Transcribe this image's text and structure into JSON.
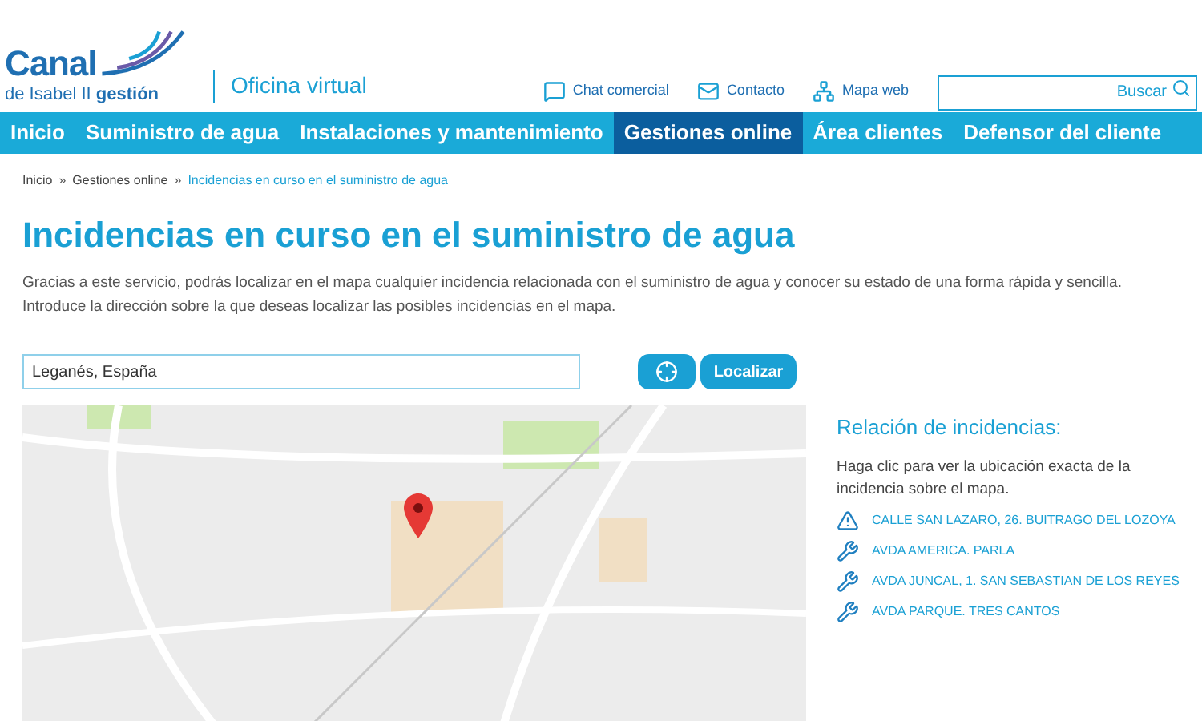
{
  "logo": {
    "name": "Canal",
    "subtitle_regular": "de Isabel II",
    "subtitle_bold": "gestión",
    "section": "Oficina virtual"
  },
  "header_links": [
    {
      "label": "Chat comercial",
      "kind": "chat"
    },
    {
      "label": "Contacto",
      "kind": "mail"
    },
    {
      "label": "Mapa web",
      "kind": "sitemap"
    }
  ],
  "search": {
    "placeholder": "Buscar"
  },
  "nav": [
    {
      "label": "Inicio",
      "selected": false
    },
    {
      "label": "Suministro de agua",
      "selected": false
    },
    {
      "label": "Instalaciones y mantenimiento",
      "selected": false
    },
    {
      "label": "Gestiones online",
      "selected": true
    },
    {
      "label": "Área clientes",
      "selected": false
    },
    {
      "label": "Defensor del cliente",
      "selected": false
    }
  ],
  "breadcrumb": {
    "separator": "»",
    "items": [
      "Inicio",
      "Gestiones online",
      "Incidencias en curso en el suministro de agua"
    ]
  },
  "title": "Incidencias en curso en el suministro de agua",
  "intro": "Gracias a este servicio, podrás localizar en el mapa cualquier incidencia relacionada con el suministro de agua y conocer su estado de una forma rápida y sencilla. Introduce la dirección sobre la que deseas localizar las posibles incidencias en el mapa.",
  "address": {
    "value": "Leganés, España"
  },
  "locate_button": "Localizar",
  "incidents": {
    "title": "Relación de incidencias:",
    "hint": "Haga clic para ver la ubicación exacta de la incidencia sobre el mapa.",
    "items": [
      {
        "label": "CALLE SAN LAZARO, 26. BUITRAGO DEL LOZOYA",
        "kind": "alert"
      },
      {
        "label": "AVDA AMERICA. PARLA",
        "kind": "repair"
      },
      {
        "label": "AVDA JUNCAL, 1. SAN SEBASTIAN DE LOS REYES",
        "kind": "repair"
      },
      {
        "label": "AVDA PARQUE. TRES CANTOS",
        "kind": "repair"
      }
    ]
  }
}
